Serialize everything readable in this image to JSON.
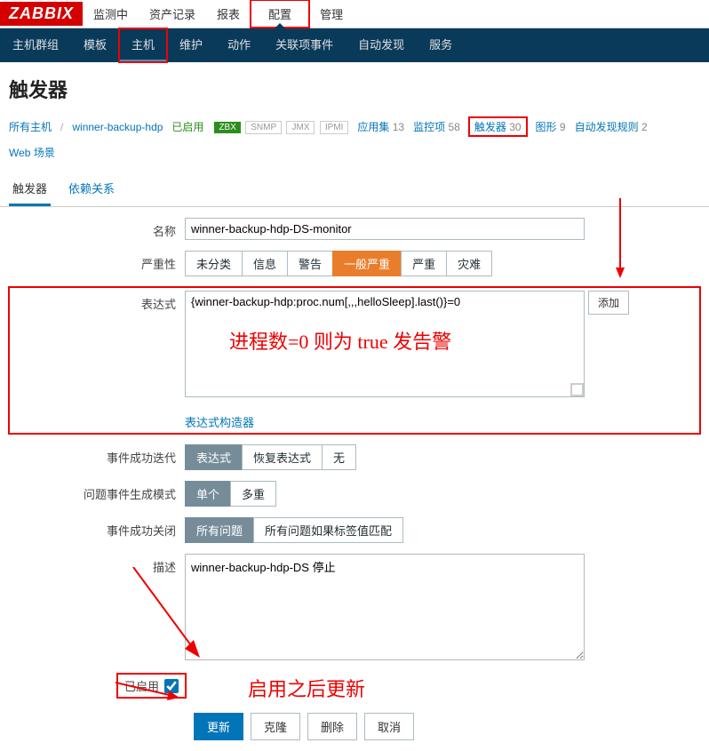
{
  "logo": "ZABBIX",
  "topnav": [
    "监测中",
    "资产记录",
    "报表",
    "配置",
    "管理"
  ],
  "topnav_active": 3,
  "subnav": [
    "主机群组",
    "模板",
    "主机",
    "维护",
    "动作",
    "关联项事件",
    "自动发现",
    "服务"
  ],
  "subnav_active": 2,
  "page_title": "触发器",
  "breadcrumb": {
    "all_hosts": "所有主机",
    "host": "winner-backup-hdp",
    "status": "已启用",
    "badges": [
      "ZBX",
      "SNMP",
      "JMX",
      "IPMI"
    ],
    "apps_label": "应用集",
    "apps_count": 13,
    "monitor_label": "监控项",
    "monitor_count": 58,
    "trigger_label": "触发器",
    "trigger_count": 30,
    "graph_label": "图形",
    "graph_count": 9,
    "discover_label": "自动发现规则",
    "discover_count": 2,
    "web_label": "Web 场景"
  },
  "tabs": {
    "trigger": "触发器",
    "dependency": "依赖关系"
  },
  "form": {
    "name_label": "名称",
    "name_value": "winner-backup-hdp-DS-monitor",
    "severity_label": "严重性",
    "severity_options": [
      "未分类",
      "信息",
      "警告",
      "一般严重",
      "严重",
      "灾难"
    ],
    "severity_active": 3,
    "expr_label": "表达式",
    "expr_value": "{winner-backup-hdp:proc.num[,,,helloSleep].last()}=0",
    "add_btn": "添加",
    "expr_builder": "表达式构造器",
    "event_iterate_label": "事件成功迭代",
    "event_iterate_options": [
      "表达式",
      "恢复表达式",
      "无"
    ],
    "event_iterate_active": 0,
    "problem_mode_label": "问题事件生成模式",
    "problem_mode_options": [
      "单个",
      "多重"
    ],
    "problem_mode_active": 0,
    "event_close_label": "事件成功关闭",
    "event_close_options": [
      "所有问题",
      "所有问题如果标签值匹配"
    ],
    "event_close_active": 0,
    "desc_label": "描述",
    "desc_value": "winner-backup-hdp-DS 停止",
    "enabled_label": "已启用",
    "enabled_checked": true
  },
  "actions": {
    "update": "更新",
    "clone": "克隆",
    "delete": "删除",
    "cancel": "取消"
  },
  "annotations": {
    "expr_note": "进程数=0 则为 true 发告警",
    "enable_note": "启用之后更新"
  }
}
